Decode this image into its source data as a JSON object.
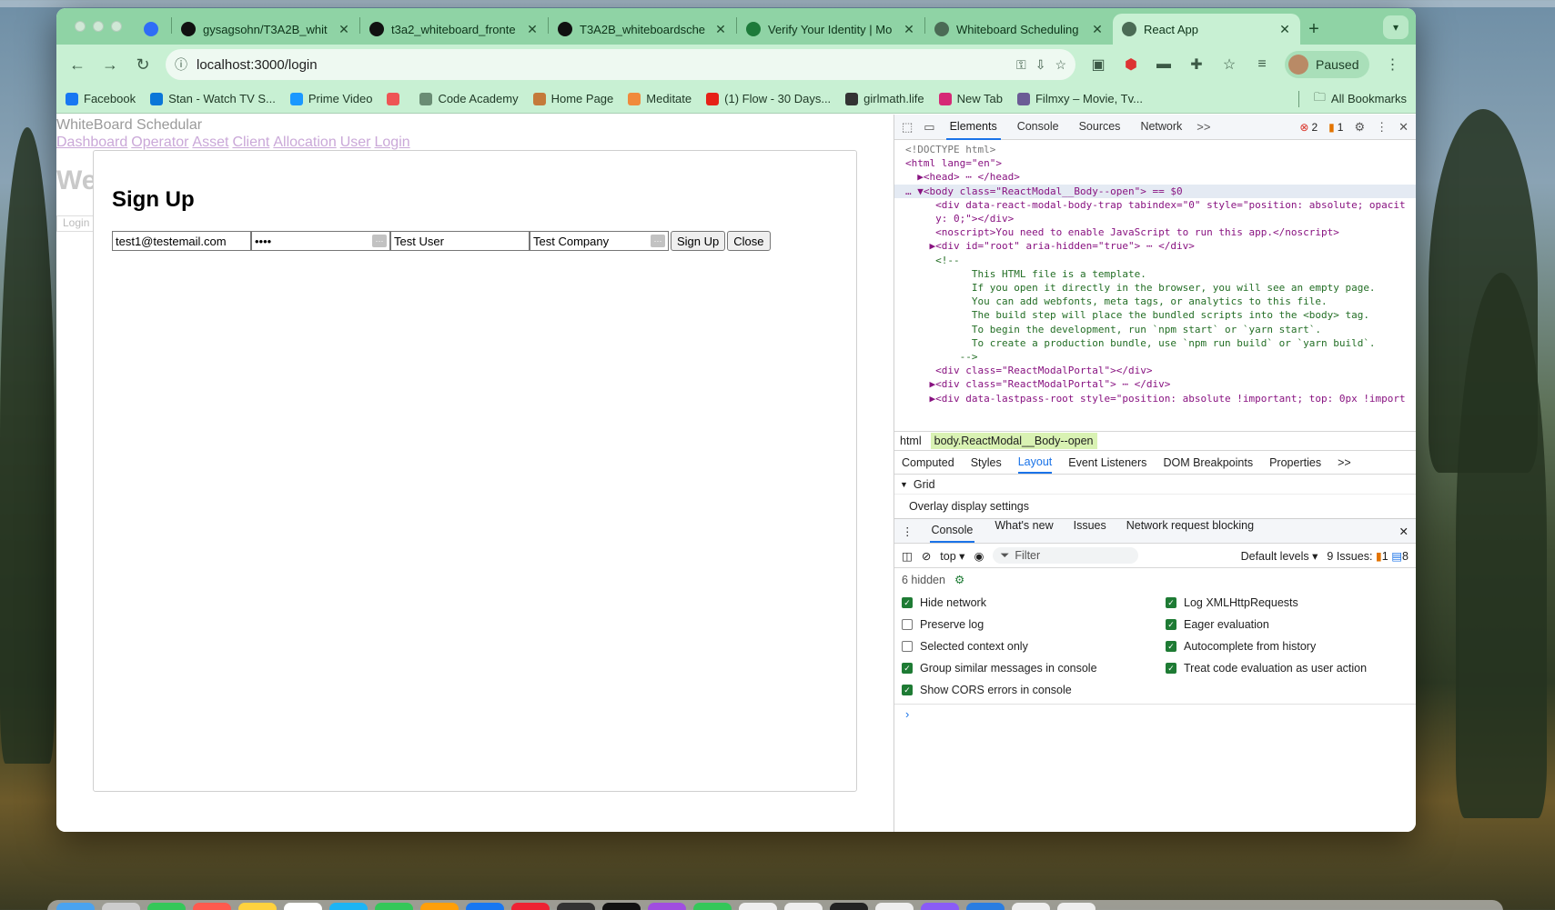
{
  "browser": {
    "tabs": [
      {
        "title": "",
        "icon": "filter-icon",
        "color": "#2f6df6"
      },
      {
        "title": "gysagsohn/T3A2B_whit",
        "icon": "github-icon",
        "color": "#111111"
      },
      {
        "title": "t3a2_whiteboard_fronte",
        "icon": "github-icon",
        "color": "#111111"
      },
      {
        "title": "T3A2B_whiteboardsche",
        "icon": "render-icon",
        "color": "#111111"
      },
      {
        "title": "Verify Your Identity | Mo",
        "icon": "mongodb-icon",
        "color": "#1d7a3a"
      },
      {
        "title": "Whiteboard Scheduling",
        "icon": "globe-icon",
        "color": "#4b6b55"
      },
      {
        "title": "React App",
        "icon": "globe-icon",
        "color": "#4b6b55"
      }
    ],
    "url": "localhost:3000/login",
    "profile_status": "Paused",
    "bookmarks": [
      {
        "label": "Facebook",
        "color": "#1877f2"
      },
      {
        "label": "Stan - Watch TV S...",
        "color": "#0a76d8"
      },
      {
        "label": "Prime Video",
        "color": "#1a98ff"
      },
      {
        "label": "",
        "color": "#e55"
      },
      {
        "label": "Code Academy",
        "color": "#6a8c74"
      },
      {
        "label": "Home Page",
        "color": "#c47a3a"
      },
      {
        "label": "Meditate",
        "color": "#f08a3c"
      },
      {
        "label": "(1) Flow - 30 Days...",
        "color": "#e62117"
      },
      {
        "label": "girlmath.life",
        "color": "#333333"
      },
      {
        "label": "New Tab",
        "color": "#d62976"
      },
      {
        "label": "Filmxy – Movie, Tv...",
        "color": "#6b5b95"
      }
    ],
    "all_bookmarks": "All Bookmarks"
  },
  "app": {
    "title": "WhiteBoard Schedular",
    "nav": [
      "Dashboard",
      "Operator",
      "Asset",
      "Client",
      "Allocation",
      "User",
      "Login"
    ],
    "welcome_partial": "We",
    "login_partial": "Login"
  },
  "modal": {
    "heading": "Sign Up",
    "email_value": "test1@testemail.com",
    "password_value": "••••",
    "name_value": "Test User",
    "company_value": "Test Company",
    "signup_label": "Sign Up",
    "close_label": "Close"
  },
  "devtools": {
    "tabs": [
      "Elements",
      "Console",
      "Sources",
      "Network"
    ],
    "more": ">>",
    "error_count": "2",
    "warning_count": "1",
    "dom_lines": [
      "<!DOCTYPE html>",
      "<html lang=\"en\">",
      "  ▶<head> ⋯ </head>",
      "… ▼<body class=\"ReactModal__Body--open\"> == $0",
      "     <div data-react-modal-body-trap tabindex=\"0\" style=\"position: absolute; opacit",
      "     y: 0;\"></div>",
      "     <noscript>You need to enable JavaScript to run this app.</noscript>",
      "    ▶<div id=\"root\" aria-hidden=\"true\"> ⋯ </div>",
      "     <!--",
      "           This HTML file is a template.",
      "           If you open it directly in the browser, you will see an empty page.",
      "",
      "           You can add webfonts, meta tags, or analytics to this file.",
      "           The build step will place the bundled scripts into the <body> tag.",
      "",
      "           To begin the development, run `npm start` or `yarn start`.",
      "           To create a production bundle, use `npm run build` or `yarn build`.",
      "         -->",
      "     <div class=\"ReactModalPortal\"></div>",
      "    ▶<div class=\"ReactModalPortal\"> ⋯ </div>",
      "    ▶<div data-lastpass-root style=\"position: absolute !important; top: 0px !import"
    ],
    "breadcrumb": [
      "html",
      "body.ReactModal__Body--open"
    ],
    "subtabs": [
      "Computed",
      "Styles",
      "Layout",
      "Event Listeners",
      "DOM Breakpoints",
      "Properties"
    ],
    "grid_label": "Grid",
    "overlay_label": "Overlay display settings",
    "drawer_tabs": [
      "Console",
      "What's new",
      "Issues",
      "Network request blocking"
    ],
    "context": "top",
    "filter_placeholder": "Filter",
    "levels": "Default levels",
    "issues_label": "9 Issues:",
    "issues_warn": "1",
    "issues_info": "8",
    "hidden_count": "6 hidden",
    "settings_left": [
      {
        "label": "Hide network",
        "checked": true
      },
      {
        "label": "Preserve log",
        "checked": false
      },
      {
        "label": "Selected context only",
        "checked": false
      },
      {
        "label": "Group similar messages in console",
        "checked": true
      },
      {
        "label": "Show CORS errors in console",
        "checked": true
      }
    ],
    "settings_right": [
      {
        "label": "Log XMLHttpRequests",
        "checked": true
      },
      {
        "label": "Eager evaluation",
        "checked": true
      },
      {
        "label": "Autocomplete from history",
        "checked": true
      },
      {
        "label": "Treat code evaluation as user action",
        "checked": true
      }
    ],
    "prompt": "›"
  }
}
